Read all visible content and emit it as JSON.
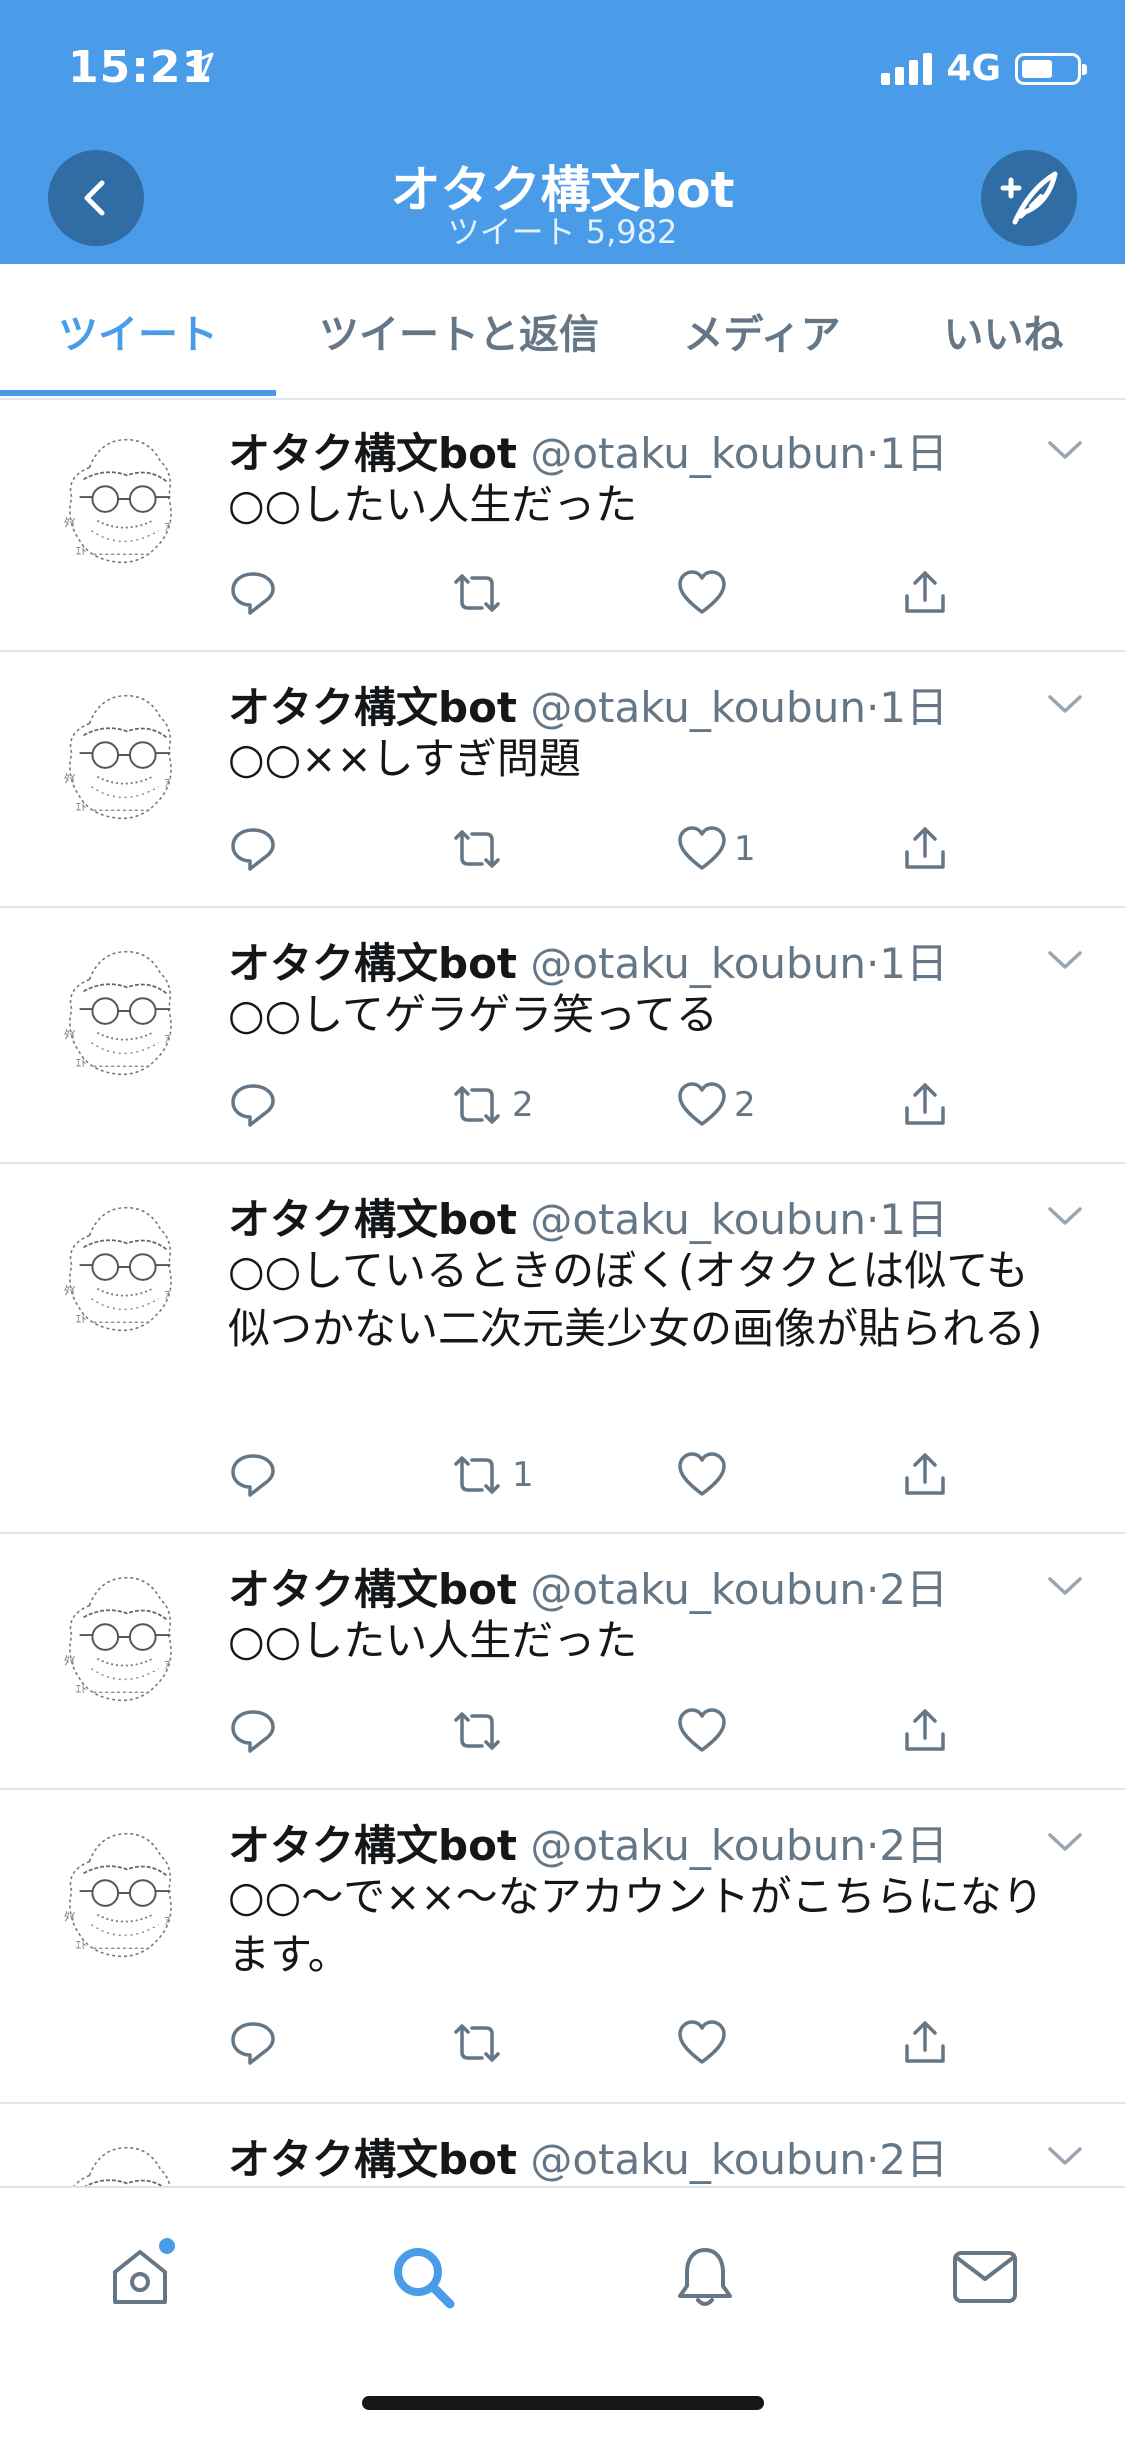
{
  "status_bar": {
    "time": "15:21",
    "network": "4G"
  },
  "header": {
    "title": "オタク構文bot",
    "subtitle": "ツイート 5,982",
    "back_icon": "chevron-left-icon",
    "compose_icon": "compose-tweet-icon"
  },
  "tabs": [
    {
      "label": "ツイート",
      "active": true
    },
    {
      "label": "ツイートと返信",
      "active": false
    },
    {
      "label": "メディア",
      "active": false
    },
    {
      "label": "いいね",
      "active": false
    }
  ],
  "tweets": [
    {
      "name": "オタク構文bot",
      "handle": "@otaku_koubun",
      "time": "·1日",
      "text": "○○したい人生だった",
      "retweets": "",
      "likes": ""
    },
    {
      "name": "オタク構文bot",
      "handle": "@otaku_koubun",
      "time": "·1日",
      "text": "○○××しすぎ問題",
      "retweets": "",
      "likes": "1"
    },
    {
      "name": "オタク構文bot",
      "handle": "@otaku_koubun",
      "time": "·1日",
      "text": "○○してゲラゲラ笑ってる",
      "retweets": "2",
      "likes": "2"
    },
    {
      "name": "オタク構文bot",
      "handle": "@otaku_koubun",
      "time": "·1日",
      "text": "○○しているときのぼく(オタクとは似ても似つかない二次元美少女の画像が貼られる)",
      "retweets": "1",
      "likes": ""
    },
    {
      "name": "オタク構文bot",
      "handle": "@otaku_koubun",
      "time": "·2日",
      "text": "○○したい人生だった",
      "retweets": "",
      "likes": ""
    },
    {
      "name": "オタク構文bot",
      "handle": "@otaku_koubun",
      "time": "·2日",
      "text": "○○〜で××〜なアカウントがこちらになります。",
      "retweets": "",
      "likes": ""
    },
    {
      "name": "オタク構文bot",
      "handle": "@otaku_koubun",
      "time": "·2日",
      "text": "",
      "retweets": "",
      "likes": ""
    }
  ],
  "bottom_nav": [
    {
      "icon": "home-icon",
      "active": false,
      "has_badge": true
    },
    {
      "icon": "search-icon",
      "active": true
    },
    {
      "icon": "notifications-bell-icon",
      "active": false
    },
    {
      "icon": "messages-envelope-icon",
      "active": false
    }
  ],
  "colors": {
    "brand": "#4a9be8",
    "header_button": "#2f6da4",
    "muted": "#657786",
    "text": "#14171a"
  }
}
